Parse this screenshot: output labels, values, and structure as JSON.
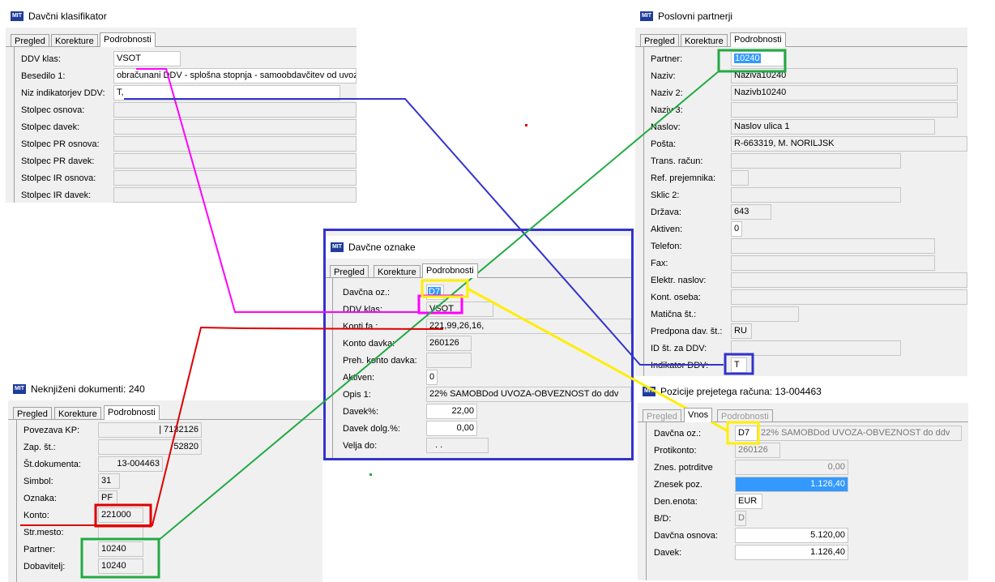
{
  "colors": {
    "magenta": "#ff00ff",
    "blue": "#3333cc",
    "green": "#22aa44",
    "red": "#dd0000",
    "yellow": "#ffee00",
    "selection": "#3399ff"
  },
  "windows": {
    "davcni": {
      "title": "Davčni klasifikator",
      "tabs": [
        "Pregled",
        "Korekture",
        "Podrobnosti"
      ],
      "fields": [
        {
          "label": "DDV klas:",
          "value": "VSOT"
        },
        {
          "label": "Besedilo 1:",
          "value": "obračunani DDV - splošna stopnja - samoobdavčitev od uvoza"
        },
        {
          "label": "Niz indikatorjev DDV:",
          "value": "T,"
        },
        {
          "label": "Stolpec osnova:",
          "value": ""
        },
        {
          "label": "Stolpec davek:",
          "value": ""
        },
        {
          "label": "Stolpec PR osnova:",
          "value": ""
        },
        {
          "label": "Stolpec PR davek:",
          "value": ""
        },
        {
          "label": "Stolpec IR osnova:",
          "value": ""
        },
        {
          "label": "Stolpec IR davek:",
          "value": ""
        }
      ]
    },
    "poslovni": {
      "title": "Poslovni partnerji",
      "tabs": [
        "Pregled",
        "Korekture",
        "Podrobnosti"
      ],
      "fields": [
        {
          "label": "Partner:",
          "value": "10240"
        },
        {
          "label": "Naziv:",
          "value": "Naziva10240"
        },
        {
          "label": "Naziv 2:",
          "value": "Nazivb10240"
        },
        {
          "label": "Naziv 3:",
          "value": ""
        },
        {
          "label": "Naslov:",
          "value": "Naslov ulica 1"
        },
        {
          "label": "Pošta:",
          "value": "R-663319, M. NORILJSK"
        },
        {
          "label": "Trans. račun:",
          "value": ""
        },
        {
          "label": "Ref. prejemnika:",
          "value": ""
        },
        {
          "label": "Sklic 2:",
          "value": ""
        },
        {
          "label": "Država:",
          "value": "643"
        },
        {
          "label": "Aktiven:",
          "value": "0"
        },
        {
          "label": "Telefon:",
          "value": ""
        },
        {
          "label": "Fax:",
          "value": ""
        },
        {
          "label": "Elektr. naslov:",
          "value": ""
        },
        {
          "label": "Kont. oseba:",
          "value": ""
        },
        {
          "label": "Matična št.:",
          "value": ""
        },
        {
          "label": "Predpona dav. št.:",
          "value": "RU"
        },
        {
          "label": "ID št. za DDV:",
          "value": ""
        },
        {
          "label": "Indikator DDV:",
          "value": "T"
        }
      ]
    },
    "oznake": {
      "title": "Davčne oznake",
      "tabs": [
        "Pregled",
        "Korekture",
        "Podrobnosti"
      ],
      "fields": [
        {
          "label": "Davčna oz.:",
          "value": "D7"
        },
        {
          "label": "DDV klas:",
          "value": "VSOT"
        },
        {
          "label": "Konti fa.:",
          "value": "221,99,26,16,"
        },
        {
          "label": "Konto davka:",
          "value": "260126"
        },
        {
          "label": "Preh. konto davka:",
          "value": ""
        },
        {
          "label": "Aktiven:",
          "value": "0"
        },
        {
          "label": "Opis 1:",
          "value": "22% SAMOBDod UVOZA-OBVEZNOST do ddv"
        },
        {
          "label": "Davek%:",
          "value": "22,00"
        },
        {
          "label": "Davek dolg.%:",
          "value": "0,00"
        },
        {
          "label": "Velja do:",
          "value": ". ."
        }
      ]
    },
    "neknjizeni": {
      "title": "Neknjiženi dokumenti: 240",
      "tabs": [
        "Pregled",
        "Korekture",
        "Podrobnosti"
      ],
      "fields": [
        {
          "label": "Povezava KP:",
          "value": "| 7132126"
        },
        {
          "label": "Zap. št.:",
          "value": "52820"
        },
        {
          "label": "Št.dokumenta:",
          "value": "13-004463"
        },
        {
          "label": "Simbol:",
          "value": "31"
        },
        {
          "label": "Oznaka:",
          "value": "PF"
        },
        {
          "label": "Konto:",
          "value": "221000"
        },
        {
          "label": "Str.mesto:",
          "value": ""
        },
        {
          "label": "Partner:",
          "value": "10240"
        },
        {
          "label": "Dobavitelj:",
          "value": "10240"
        }
      ]
    },
    "pozicije": {
      "title": "Pozicije prejetega računa: 13-004463",
      "tabs": [
        "Pregled",
        "Vnos",
        "Podrobnosti"
      ],
      "fields": [
        {
          "label": "Davčna oz.:",
          "value": "D7",
          "extra": "22% SAMOBDod UVOZA-OBVEZNOST do ddv"
        },
        {
          "label": "Protikonto:",
          "value": "260126"
        },
        {
          "label": "Znes. potrditve",
          "value": "0,00"
        },
        {
          "label": "Znesek poz.",
          "value": "1.126,40"
        },
        {
          "label": "Den.enota:",
          "value": "EUR"
        },
        {
          "label": "B/D:",
          "value": "D"
        },
        {
          "label": "Davčna osnova:",
          "value": "5.120,00"
        },
        {
          "label": "Davek:",
          "value": "1.126,40"
        }
      ]
    }
  }
}
